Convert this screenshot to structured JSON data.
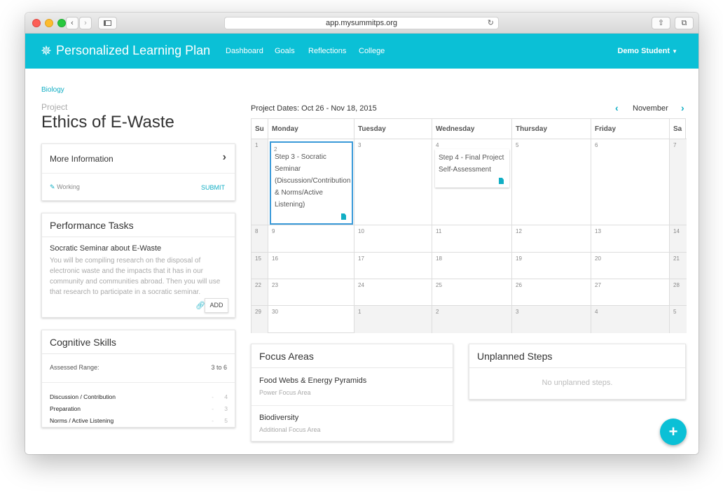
{
  "browser": {
    "url": "app.mysummitps.org"
  },
  "app": {
    "title": "Personalized Learning Plan",
    "nav": [
      "Dashboard",
      "Goals",
      "Reflections",
      "College"
    ],
    "user": "Demo Student",
    "brand_color": "#0bc0d6"
  },
  "page": {
    "breadcrumb": "Biology",
    "project_label": "Project",
    "project_title": "Ethics of E-Waste"
  },
  "info_card": {
    "more_info": "More Information",
    "status": "Working",
    "submit": "SUBMIT"
  },
  "performance_tasks": {
    "header": "Performance Tasks",
    "task_title": "Socratic Seminar about E-Waste",
    "task_desc": "You will be compiling research on the disposal of electronic waste and the impacts that it has in our community and communities abroad. Then you will use that research to participate in a socratic seminar.",
    "add": "ADD"
  },
  "cognitive_skills": {
    "header": "Cognitive Skills",
    "range_label": "Assessed Range:",
    "range_value": "3 to 6",
    "skills": [
      {
        "name": "Discussion / Contribution",
        "dash": "-",
        "value": "4"
      },
      {
        "name": "Preparation",
        "dash": "-",
        "value": "3"
      },
      {
        "name": "Norms / Active Listening",
        "dash": "-",
        "value": "5"
      }
    ]
  },
  "calendar": {
    "project_dates": "Project Dates: Oct 26 - Nov 18, 2015",
    "month": "November",
    "days": [
      "Su",
      "Monday",
      "Tuesday",
      "Wednesday",
      "Thursday",
      "Friday",
      "Sa"
    ],
    "weeks": [
      [
        "1",
        "2",
        "3",
        "4",
        "5",
        "6",
        "7"
      ],
      [
        "8",
        "9",
        "10",
        "11",
        "12",
        "13",
        "14"
      ],
      [
        "15",
        "16",
        "17",
        "18",
        "19",
        "20",
        "21"
      ],
      [
        "22",
        "23",
        "24",
        "25",
        "26",
        "27",
        "28"
      ],
      [
        "29",
        "30",
        "1",
        "2",
        "3",
        "4",
        "5"
      ]
    ],
    "events": [
      {
        "text": "Step 3 - Socratic Seminar (Discussion/Contribution & Norms/Active Listening)"
      },
      {
        "text": "Step 4 - Final Project Self-Assessment"
      }
    ]
  },
  "focus_areas": {
    "header": "Focus Areas",
    "items": [
      {
        "title": "Food Webs & Energy Pyramids",
        "sub": "Power Focus Area"
      },
      {
        "title": "Biodiversity",
        "sub": "Additional Focus Area"
      }
    ]
  },
  "unplanned": {
    "header": "Unplanned Steps",
    "empty": "No unplanned steps."
  },
  "fab": {
    "label": "+"
  }
}
